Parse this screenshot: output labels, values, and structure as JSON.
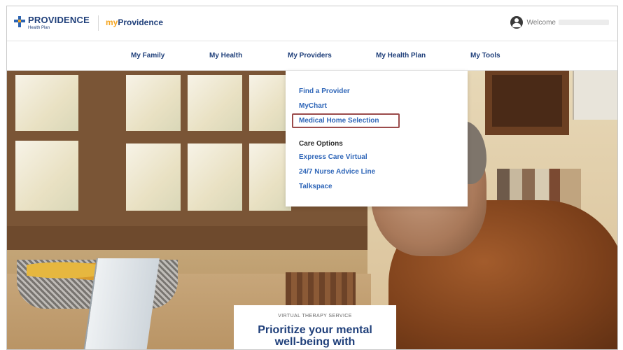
{
  "header": {
    "brand": "PROVIDENCE",
    "brand_sub": "Health Plan",
    "app_name_prefix": "my",
    "app_name_main": "Providence",
    "welcome_label": "Welcome"
  },
  "nav": {
    "items": [
      {
        "label": "My Family"
      },
      {
        "label": "My Health"
      },
      {
        "label": "My Providers"
      },
      {
        "label": "My Health Plan"
      },
      {
        "label": "My Tools"
      }
    ]
  },
  "dropdown": {
    "items": [
      {
        "label": "Find a Provider"
      },
      {
        "label": "MyChart"
      },
      {
        "label": "Medical Home Selection"
      }
    ],
    "care_options_heading": "Care Options",
    "care_items": [
      {
        "label": "Express Care Virtual"
      },
      {
        "label": "24/7 Nurse Advice Line"
      },
      {
        "label": "Talkspace"
      }
    ]
  },
  "promo": {
    "kicker": "VIRTUAL THERAPY SERVICE",
    "title_line1": "Prioritize your mental",
    "title_line2": "well-being with"
  },
  "colors": {
    "brand_blue": "#1f3f7a",
    "link_blue": "#2f66b8",
    "accent_orange": "#f5a623",
    "highlight_border": "#9b4b4b"
  }
}
